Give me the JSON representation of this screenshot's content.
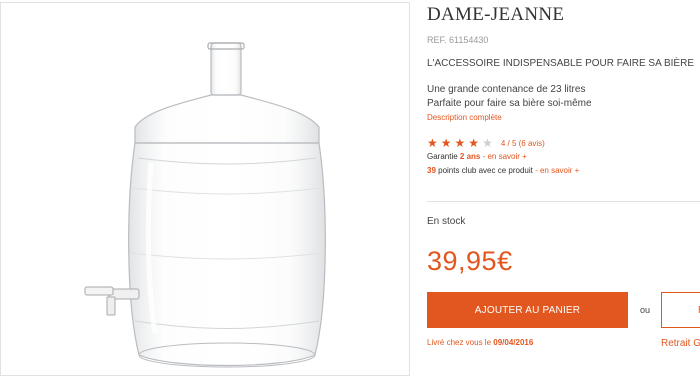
{
  "product": {
    "title": "DAME-JEANNE",
    "ref": "REF. 61154430",
    "tagline": "L'ACCESSOIRE INDISPENSABLE POUR FAIRE SA BIÈRE",
    "features": [
      "Une grande contenance de 23 litres",
      "Parfaite pour faire sa bière soi-même"
    ],
    "description_link": "Description complète",
    "rating": {
      "value": 4,
      "max": 5,
      "text": "4 / 5 (6 avis)"
    },
    "warranty": {
      "prefix": "Garantie ",
      "years": "2 ans",
      "link": " - en savoir +"
    },
    "points": {
      "count": "39",
      "text": " points club avec ce produit",
      "link": " - en savoir +"
    },
    "stock": "En stock",
    "price": "39,95€"
  },
  "actions": {
    "add_to_cart": "AJOUTER AU PANIER",
    "or": "ou",
    "pickup_button": "R",
    "delivery_prefix": "Livré chez vous le ",
    "delivery_date": "09/04/2016",
    "pickup_note": "Retrait G"
  },
  "colors": {
    "accent": "#e2571f",
    "text": "#333333",
    "muted": "#999999",
    "border": "#e2e2e2"
  },
  "icons": {
    "star_filled": "star-filled-icon",
    "star_empty": "star-empty-icon"
  }
}
